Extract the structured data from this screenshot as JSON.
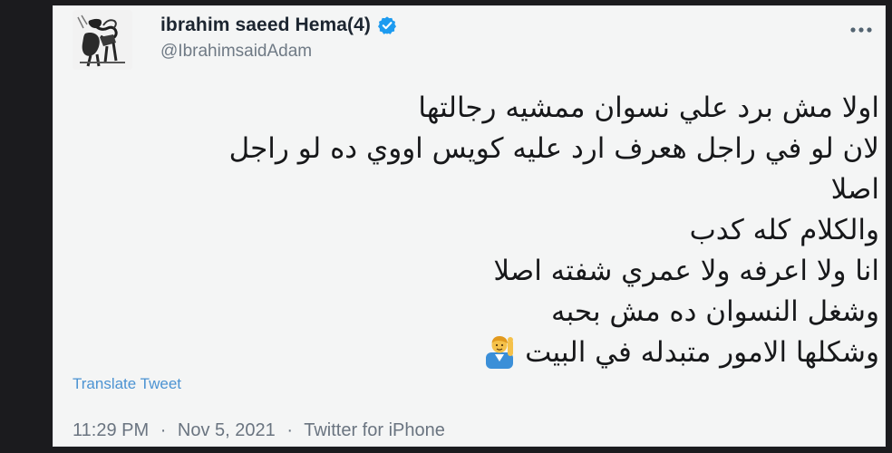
{
  "author": {
    "display_name": "ibrahim saeed Hema(4)",
    "handle": "@IbrahimsaidAdam",
    "verified": true,
    "avatar_icon": "avatar-sketch-figure"
  },
  "menu": {
    "icon": "more-options-icon"
  },
  "tweet": {
    "lines": [
      "اولا مش برد علي نسوان ممشيه رجالتها",
      "لان لو في راجل هعرف ارد عليه كويس اووي ده لو راجل",
      "اصلا",
      "والكلام كله كدب",
      "انا ولا اعرفه ولا عمري شفته اصلا",
      "وشغل النسوان ده مش بحبه",
      "وشكلها الامور متبدله في البيت"
    ],
    "emoji": "hand-raising-person-emoji"
  },
  "translate_label": "Translate Tweet",
  "meta": {
    "time": "11:29 PM",
    "date": "Nov 5, 2021",
    "source": "Twitter for iPhone",
    "separator": "·"
  },
  "colors": {
    "background": "#1b1b1e",
    "card": "#f4f5f5",
    "text": "#17181a",
    "name": "#1c2530",
    "secondary": "#6f7a85",
    "link": "#4c93d2",
    "verified": "#1d9bf0"
  }
}
